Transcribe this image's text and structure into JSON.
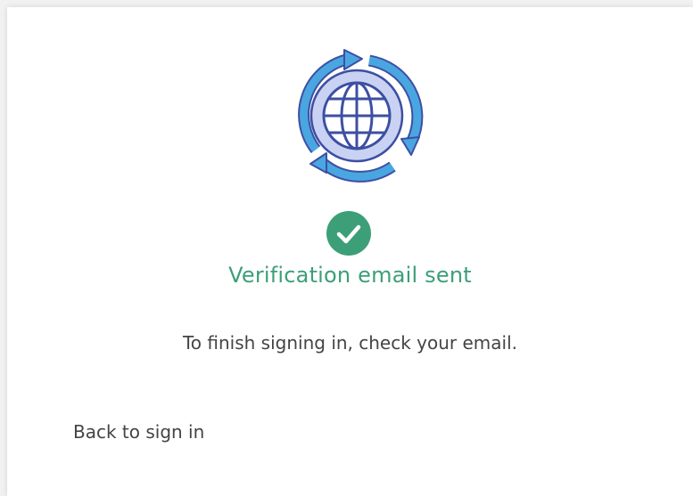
{
  "status": {
    "title": "Verification email sent",
    "message": "To finish signing in, check your email."
  },
  "actions": {
    "back_label": "Back to sign in"
  },
  "colors": {
    "success": "#3c9f78",
    "globe_fill": "#c9d2f2",
    "globe_stroke": "#3d4fa3",
    "arrow_fill": "#4aa6e0"
  },
  "icons": {
    "hero": "globe-with-sync-arrows-icon",
    "status": "check-circle-icon"
  }
}
